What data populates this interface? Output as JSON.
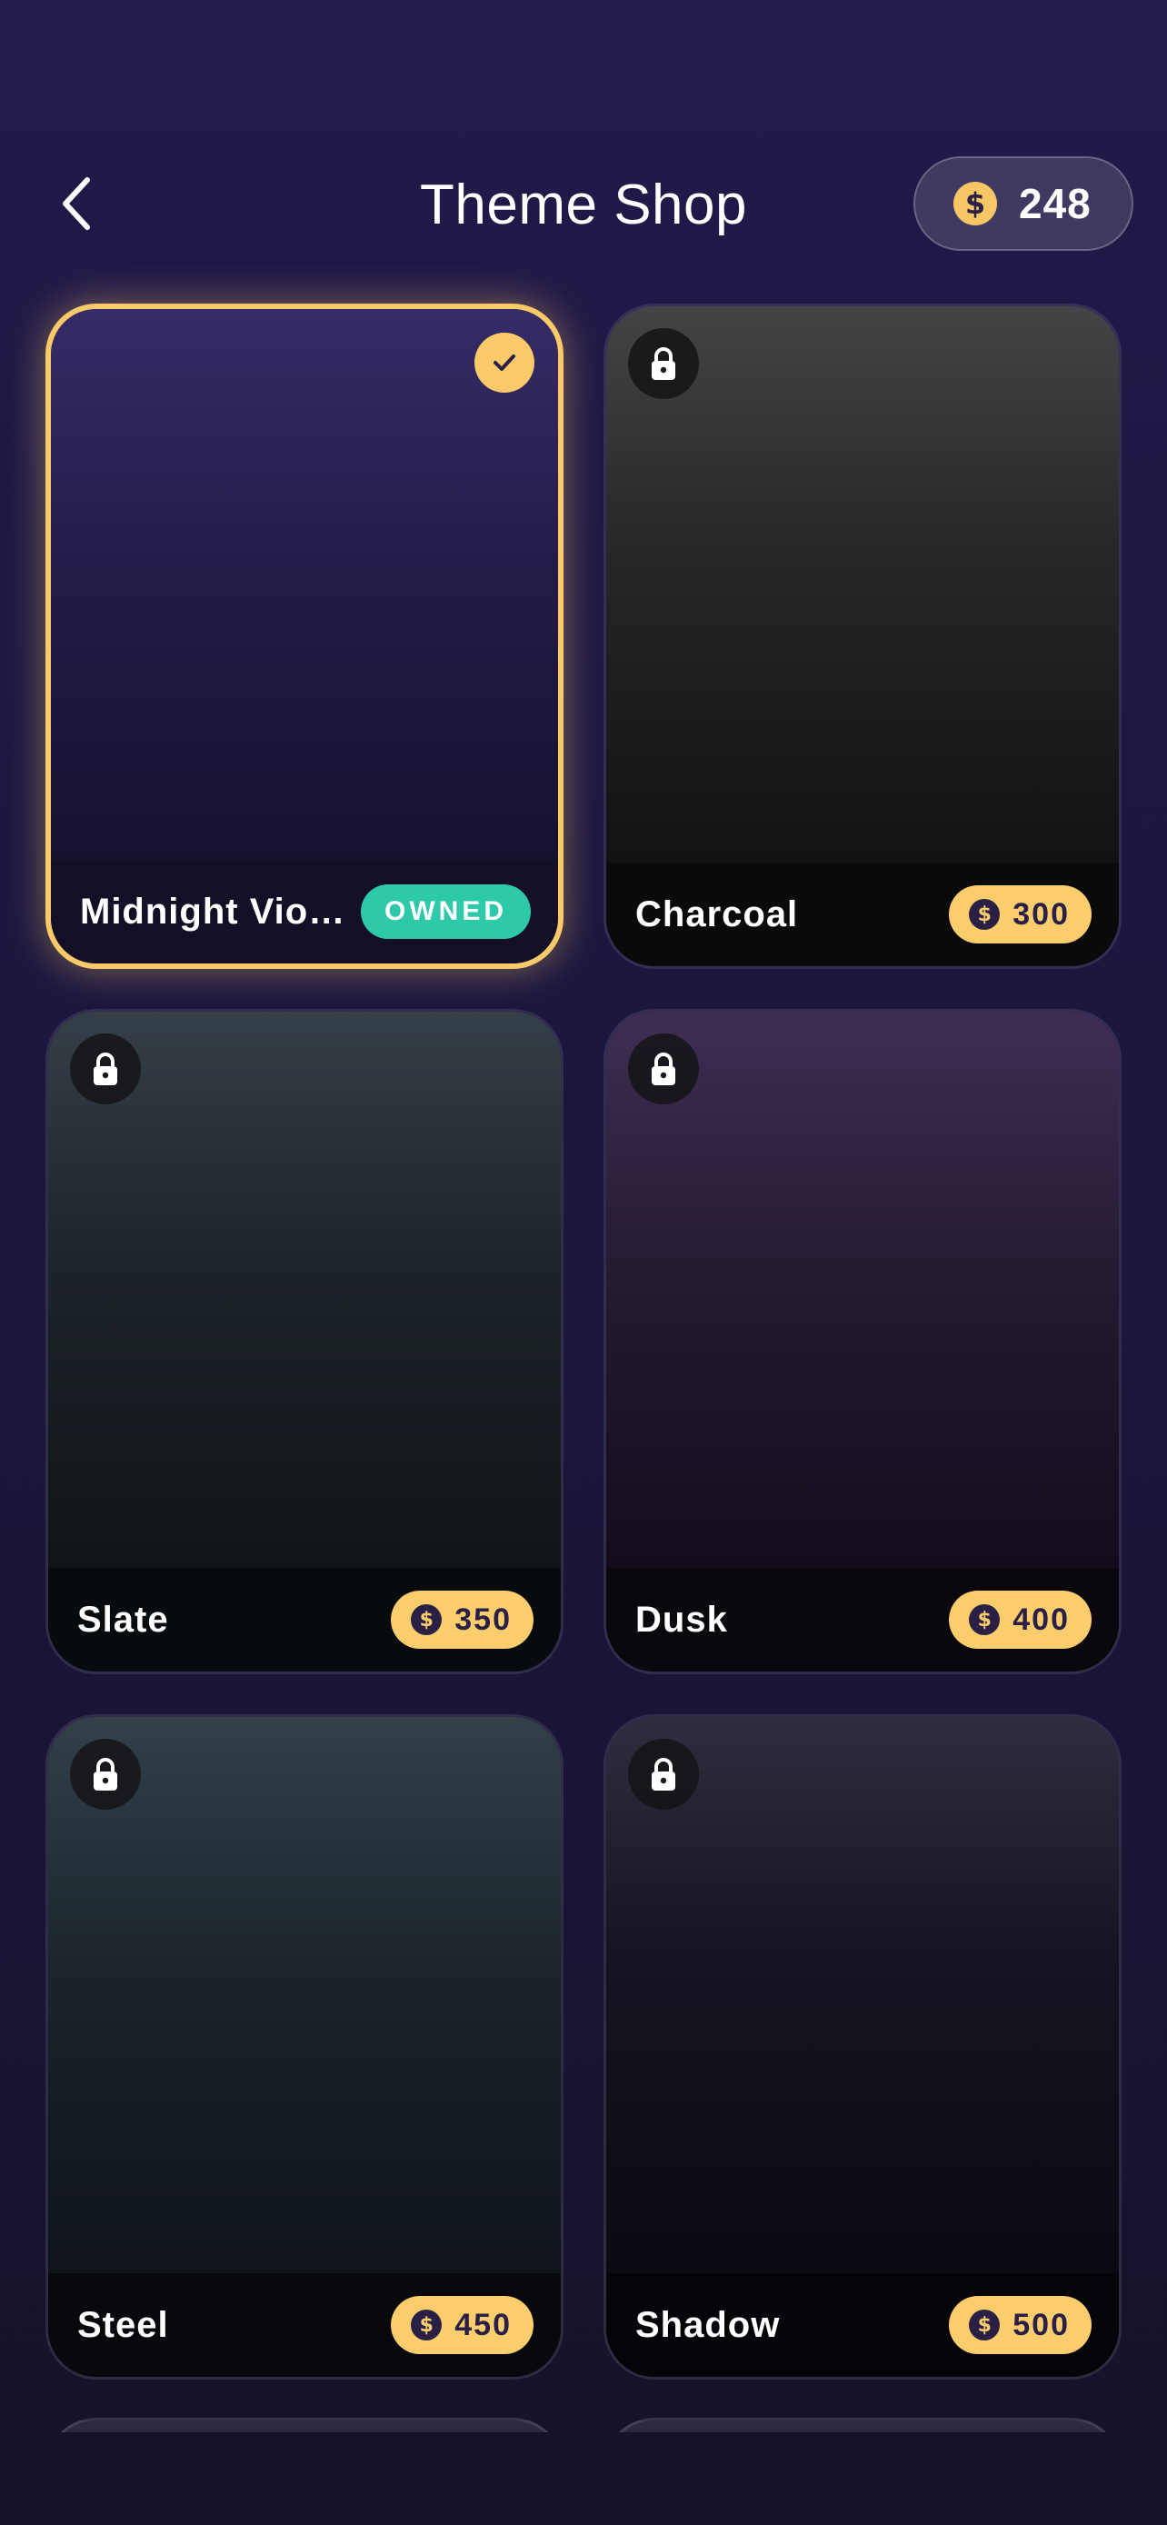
{
  "header": {
    "title": "Theme Shop",
    "balance": "248",
    "back_icon": "chevron-left-icon",
    "coin_symbol": "$"
  },
  "themes": [
    {
      "name": "Midnight Vio…",
      "status": "owned",
      "badge_label": "OWNED",
      "selected": true
    },
    {
      "name": "Charcoal",
      "status": "locked",
      "price": "300"
    },
    {
      "name": "Slate",
      "status": "locked",
      "price": "350"
    },
    {
      "name": "Dusk",
      "status": "locked",
      "price": "400"
    },
    {
      "name": "Steel",
      "status": "locked",
      "price": "450"
    },
    {
      "name": "Shadow",
      "status": "locked",
      "price": "500"
    }
  ],
  "colors": {
    "accent": "#f9c96a",
    "owned_badge": "#2ec9a9",
    "background": "#1c1740"
  }
}
